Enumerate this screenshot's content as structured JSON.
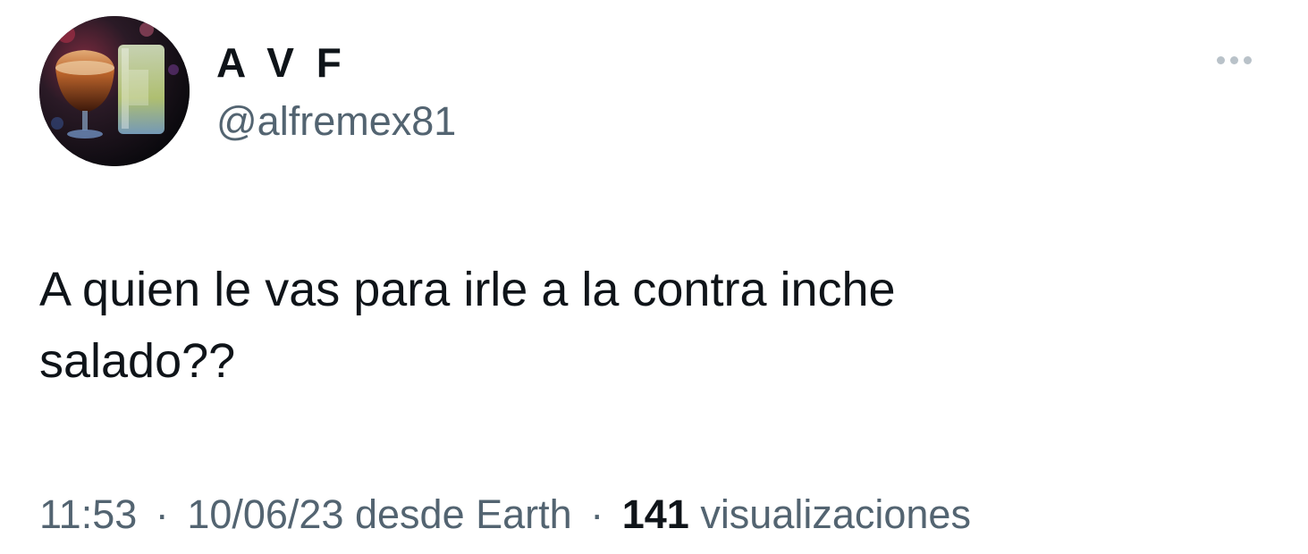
{
  "author": {
    "name": "A V F",
    "handle": "@alfremex81"
  },
  "tweet": {
    "line1": "A quien le vas para irle a la contra inche",
    "line2": "salado??"
  },
  "meta": {
    "time": "11:53",
    "separator": "·",
    "date": "10/06/23",
    "source": "desde Earth",
    "views_count": "141",
    "views_label": "visualizaciones"
  },
  "icons": {
    "more": "more-options-icon"
  },
  "colors": {
    "text_primary": "#0f1419",
    "text_secondary": "#536471",
    "more_dots": "#b9c2c9"
  }
}
